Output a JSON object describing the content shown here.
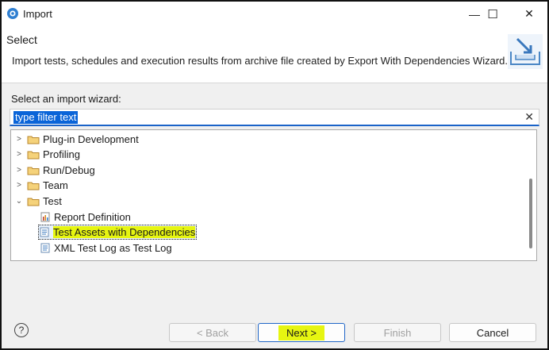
{
  "window": {
    "title": "Import",
    "minimize": "—",
    "maximize": "☐",
    "close": "✕"
  },
  "header": {
    "title": "Select",
    "description": "Import tests, schedules and execution results from archive file created by Export With Dependencies Wizard."
  },
  "main": {
    "prompt": "Select an import wizard:",
    "filter": {
      "value": "type filter text",
      "clear_icon": "✕"
    }
  },
  "tree": {
    "items": [
      {
        "label": "Plug-in Development",
        "type": "folder",
        "expanded": false
      },
      {
        "label": "Profiling",
        "type": "folder",
        "expanded": false
      },
      {
        "label": "Run/Debug",
        "type": "folder",
        "expanded": false
      },
      {
        "label": "Team",
        "type": "folder",
        "expanded": false
      },
      {
        "label": "Test",
        "type": "folder",
        "expanded": true
      },
      {
        "label": "Report Definition",
        "type": "leaf",
        "icon": "report-icon"
      },
      {
        "label": "Test Assets with Dependencies",
        "type": "leaf",
        "icon": "file-icon",
        "selected": true
      },
      {
        "label": "XML Test Log as Test Log",
        "type": "leaf",
        "icon": "file-icon"
      }
    ]
  },
  "footer": {
    "help": "?",
    "back": "< Back",
    "next": "Next >",
    "finish": "Finish",
    "cancel": "Cancel"
  },
  "colors": {
    "accent": "#0a64d8",
    "highlight": "#e6f511",
    "folder": "#e8b04a"
  }
}
